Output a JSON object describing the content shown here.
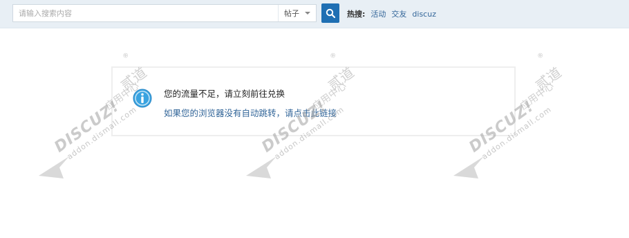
{
  "header": {
    "search": {
      "placeholder": "请输入搜索内容",
      "value": ""
    },
    "scope": "帖子",
    "hot_label": "热搜:",
    "hot_items": [
      "活动",
      "交友",
      "discuz"
    ]
  },
  "message": {
    "text": "您的流量不足，请立刻前往兑换",
    "link": "如果您的浏览器没有自动跳转，请点击此链接"
  },
  "watermark": {
    "brand": "DISCUZ!",
    "app_center": "应用中心",
    "site": "addon.dismall.com",
    "maker": "贰道",
    "reg": "®"
  },
  "colors": {
    "topbar_bg": "#e8eff5",
    "button_bg": "#1f6fb3",
    "link": "#336699",
    "info_icon": "#3aa3e0"
  }
}
